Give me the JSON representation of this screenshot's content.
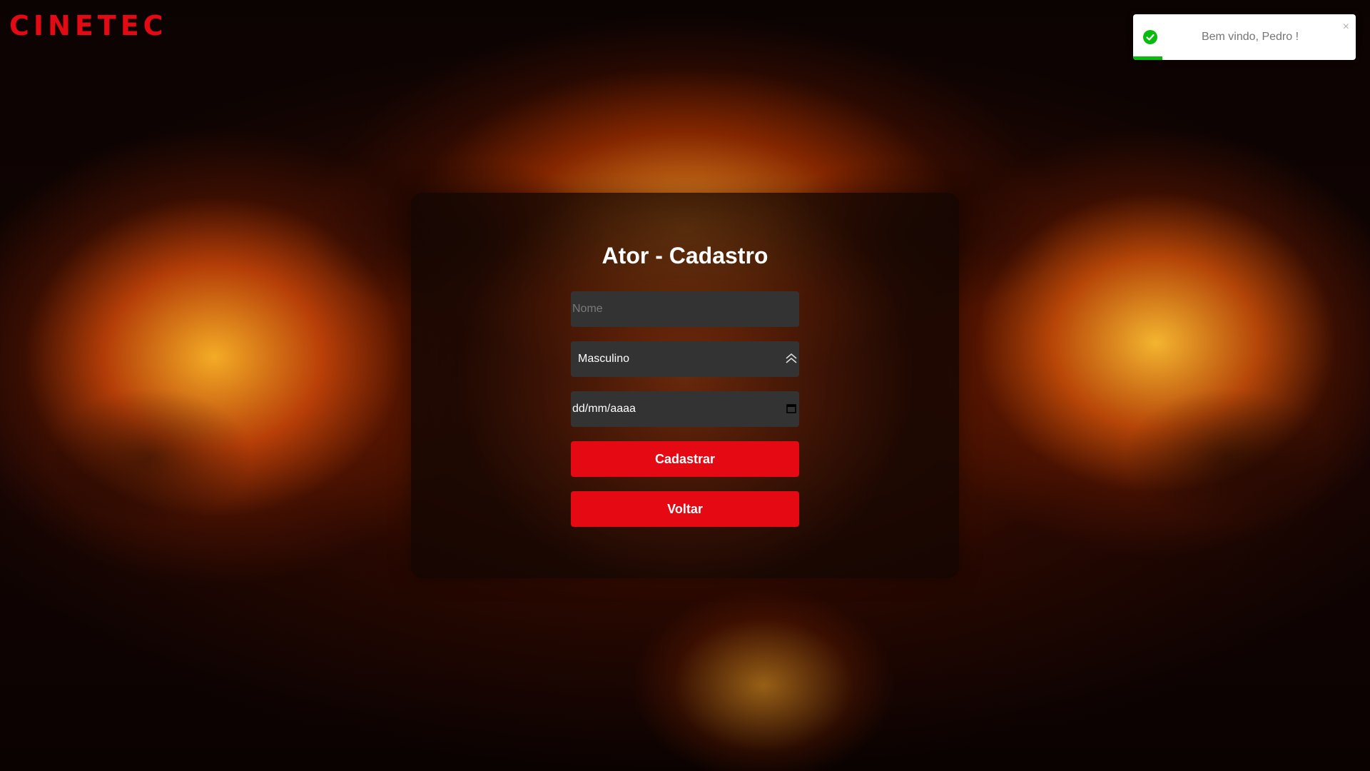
{
  "brand": {
    "logo": "CINETEC",
    "accent_color": "#e50914"
  },
  "toast": {
    "message": "Bem vindo, Pedro !",
    "icon": "check-circle-icon",
    "close_label": "×",
    "type": "success",
    "color": "#07bc0c",
    "progress": 0.13
  },
  "form": {
    "title": "Ator - Cadastro",
    "nome": {
      "placeholder": "Nome",
      "value": ""
    },
    "genero": {
      "selected": "Masculino",
      "icon": "chevron-up-double-icon"
    },
    "data_nascimento": {
      "value": "dd/mm/aaaa",
      "icon": "calendar-icon"
    },
    "submit_label": "Cadastrar",
    "back_label": "Voltar"
  }
}
